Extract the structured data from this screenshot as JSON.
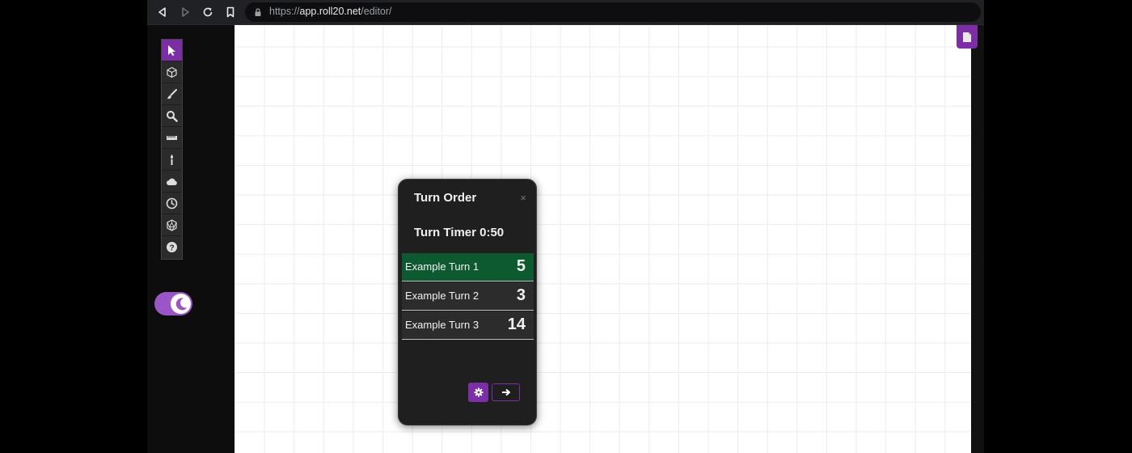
{
  "browser": {
    "url_scheme": "https://",
    "url_host": "app.roll20.net",
    "url_path": "/editor/"
  },
  "toolbar": {
    "tools": [
      {
        "icon": "select-cursor-icon",
        "active": true
      },
      {
        "icon": "cube-icon",
        "active": false
      },
      {
        "icon": "brush-icon",
        "active": false
      },
      {
        "icon": "zoom-icon",
        "active": false
      },
      {
        "icon": "ruler-icon",
        "active": false
      },
      {
        "icon": "torch-icon",
        "active": false
      },
      {
        "icon": "cloud-icon",
        "active": false
      },
      {
        "icon": "clock-icon",
        "active": false
      },
      {
        "icon": "dice-icon",
        "active": false
      },
      {
        "icon": "help-icon",
        "active": false
      }
    ]
  },
  "theme_toggle": {
    "icon": "moon-icon",
    "state": "on"
  },
  "turn_order": {
    "title": "Turn Order",
    "close_symbol": "×",
    "timer": "Turn Timer 0:50",
    "turns": [
      {
        "name": "Example Turn 1",
        "initiative": "5",
        "current": true
      },
      {
        "name": "Example Turn 2",
        "initiative": "3",
        "current": false
      },
      {
        "name": "Example Turn 3",
        "initiative": "14",
        "current": false
      }
    ]
  },
  "colors": {
    "accent": "#7b2ea6",
    "current_turn": "#0e5a30",
    "toggle": "#9a56c6"
  }
}
